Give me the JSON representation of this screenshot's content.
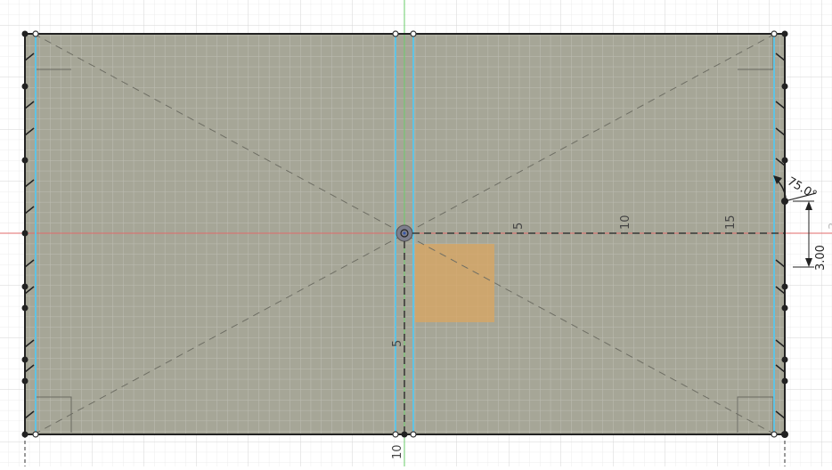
{
  "sketch": {
    "ruler_h": [
      "5",
      "10",
      "15"
    ],
    "ruler_v": [
      "5",
      "10"
    ],
    "angle_dimension": "75.0°",
    "offset_dimension": "3.00",
    "edge_dimension_partial": "3"
  },
  "colors": {
    "canvas_bg": "#ffffff",
    "grid_minor": "#ececec",
    "grid_major": "#d6d6d6",
    "profile_fill": "#9e9e8e",
    "highlight_fill": "#d9a660",
    "construction_line": "#5fc3e4",
    "x_axis": "#e06a6a",
    "y_axis": "#6acc6a",
    "sketch_line": "#222222"
  }
}
